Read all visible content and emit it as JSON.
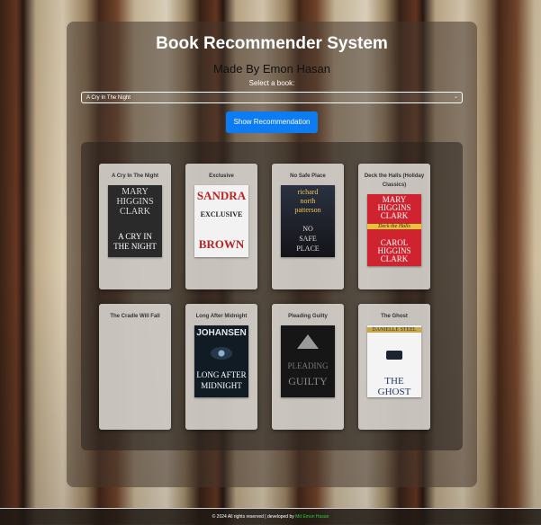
{
  "header": {
    "title": "Book Recommender System",
    "subtitle": "Made By Emon Hasan"
  },
  "select": {
    "label": "Select a book:",
    "value": "A Cry In The Night"
  },
  "button": {
    "label": "Show Recommendation"
  },
  "books": [
    {
      "title": "A Cry In The Night",
      "cover_lines": [
        "MARY",
        "HIGGINS",
        "CLARK",
        "A CRY IN",
        "THE NIGHT"
      ]
    },
    {
      "title": "Exclusive",
      "cover_lines": [
        "SANDRA",
        "EXCLUSIVE",
        "BROWN"
      ]
    },
    {
      "title": "No Safe Place",
      "cover_lines": [
        "richard",
        "north",
        "patterson",
        "NO",
        "SAFE",
        "PLACE"
      ]
    },
    {
      "title": "Deck the Halls (Holiday Classics)",
      "cover_lines": [
        "MARY",
        "HIGGINS",
        "CLARK",
        "Deck the Halls",
        "CAROL",
        "HIGGINS",
        "CLARK"
      ]
    },
    {
      "title": "The Cradle Will Fall",
      "cover_lines": []
    },
    {
      "title": "Long After Midnight",
      "cover_lines": [
        "JOHANSEN",
        "LONG AFTER",
        "MIDNIGHT"
      ]
    },
    {
      "title": "Pleading Guilty",
      "cover_lines": [
        "PLEADING",
        "GUILTY"
      ]
    },
    {
      "title": "The Ghost",
      "cover_lines": [
        "DANIELLE STEEL",
        "THE GHOST"
      ]
    }
  ],
  "footer": {
    "text": "© 2024 All rights reserved | developed by",
    "developer": "Md Emon Hasan"
  },
  "colors": {
    "accent": "#0d7cf2",
    "developer_link": "#2ecc40"
  }
}
